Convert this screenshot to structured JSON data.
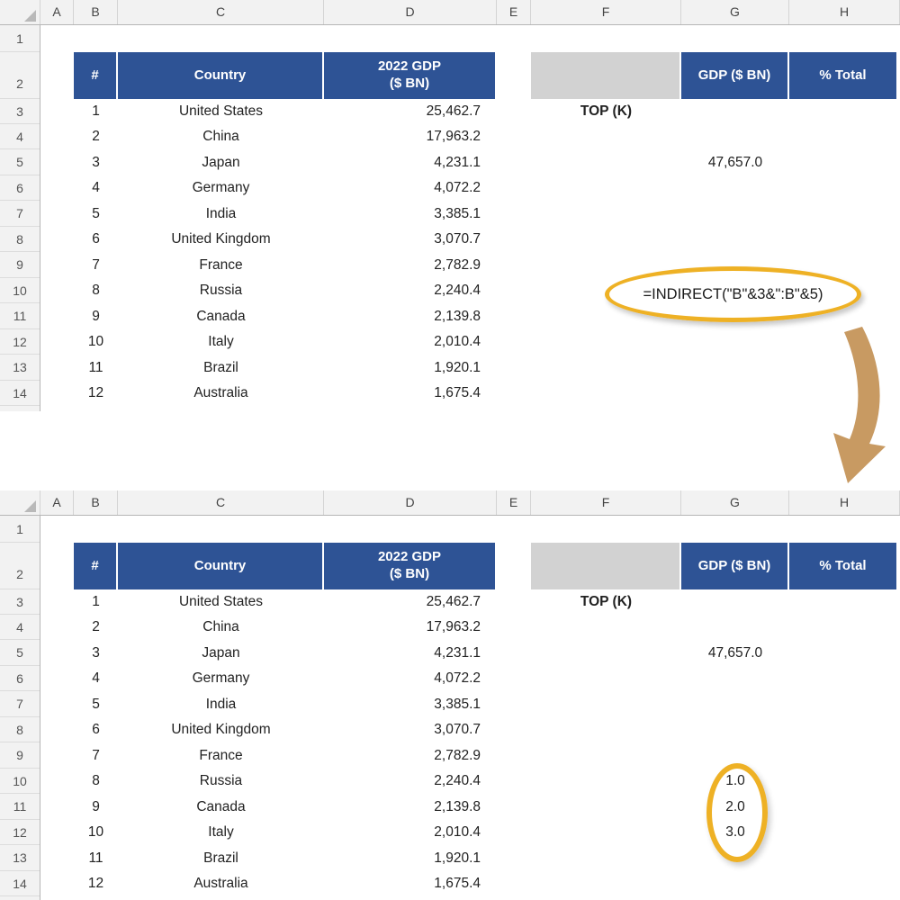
{
  "meta": {
    "app": "spreadsheet",
    "colors": {
      "header_blue": "#2e5395",
      "grey_cell": "#d2d2d2",
      "annotation_gold": "#eeb125",
      "arrow_tan": "#c89a62",
      "grid_line": "#dcdcdc",
      "row_header_bg": "#f2f2f2"
    }
  },
  "grid": {
    "column_letters": [
      "A",
      "B",
      "C",
      "D",
      "E",
      "F",
      "G",
      "H"
    ],
    "row_numbers": [
      "1",
      "2",
      "3",
      "4",
      "5",
      "6",
      "7",
      "8",
      "9",
      "10",
      "11",
      "12",
      "13",
      "14"
    ]
  },
  "table": {
    "headers": {
      "num": "#",
      "country": "Country",
      "gdp_line1": "2022 GDP",
      "gdp_line2": "($ BN)"
    },
    "rows": [
      {
        "num": "1",
        "country": "United States",
        "gdp": "25,462.7"
      },
      {
        "num": "2",
        "country": "China",
        "gdp": "17,963.2"
      },
      {
        "num": "3",
        "country": "Japan",
        "gdp": "4,231.1"
      },
      {
        "num": "4",
        "country": "Germany",
        "gdp": "4,072.2"
      },
      {
        "num": "5",
        "country": "India",
        "gdp": "3,385.1"
      },
      {
        "num": "6",
        "country": "United Kingdom",
        "gdp": "3,070.7"
      },
      {
        "num": "7",
        "country": "France",
        "gdp": "2,782.9"
      },
      {
        "num": "8",
        "country": "Russia",
        "gdp": "2,240.4"
      },
      {
        "num": "9",
        "country": "Canada",
        "gdp": "2,139.8"
      },
      {
        "num": "10",
        "country": "Italy",
        "gdp": "2,010.4"
      },
      {
        "num": "11",
        "country": "Brazil",
        "gdp": "1,920.1"
      },
      {
        "num": "12",
        "country": "Australia",
        "gdp": "1,675.4"
      }
    ]
  },
  "summary": {
    "blank_header": "",
    "gdp_header": "GDP ($ BN)",
    "pct_header": "% Total",
    "top_k_label": "TOP (K)",
    "total_value": "47,657.0"
  },
  "annotations": {
    "formula": "=INDIRECT(\"B\"&3&\":B\"&5)",
    "arrow": "curved-down-arrow",
    "result_values": [
      "1.0",
      "2.0",
      "3.0"
    ]
  }
}
